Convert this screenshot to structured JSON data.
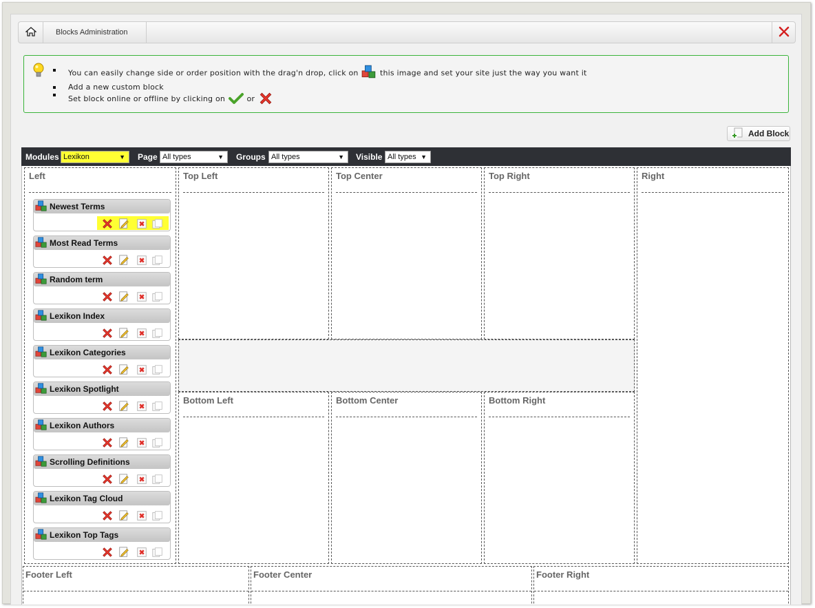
{
  "breadcrumb": {
    "title": "Blocks Administration"
  },
  "info": {
    "line1_before": "You can easily change side or order position with the drag'n drop, click on",
    "line1_after": "this image and set your site just the way you want it",
    "line2": "Add a new custom block",
    "line3_before": "Set block online or offline by clicking on",
    "line3_or": "or"
  },
  "toolbar": {
    "add_block_label": "Add Block"
  },
  "filters": {
    "modules_label": "Modules",
    "modules_value": "Lexikon",
    "page_label": "Page",
    "page_value": "All types",
    "groups_label": "Groups",
    "groups_value": "All types",
    "visible_label": "Visible",
    "visible_value": "All types"
  },
  "zones": {
    "left": "Left",
    "top_left": "Top Left",
    "top_center": "Top Center",
    "top_right": "Top Right",
    "right": "Right",
    "bottom_left": "Bottom Left",
    "bottom_center": "Bottom Center",
    "bottom_right": "Bottom Right",
    "footer_left": "Footer Left",
    "footer_center": "Footer Center",
    "footer_right": "Footer Right"
  },
  "blocks": [
    "Newest Terms",
    "Most Read Terms",
    "Random term",
    "Lexikon Index",
    "Lexikon Categories",
    "Lexikon Spotlight",
    "Lexikon Authors",
    "Scrolling Definitions",
    "Lexikon Tag Cloud",
    "Lexikon Top Tags"
  ],
  "colors": {
    "highlight": "#ffff33",
    "info_border": "#39b339",
    "filter_bar": "#2e3035"
  },
  "icons": {
    "home": "home-icon",
    "close": "close-icon",
    "hint": "lightbulb-icon",
    "drag": "cubes-icon",
    "online": "check-icon",
    "offline": "x-icon",
    "add": "add-block-icon",
    "delete": "delete-icon",
    "edit": "edit-icon",
    "small_delete": "small-delete-icon",
    "clone": "clone-icon"
  }
}
